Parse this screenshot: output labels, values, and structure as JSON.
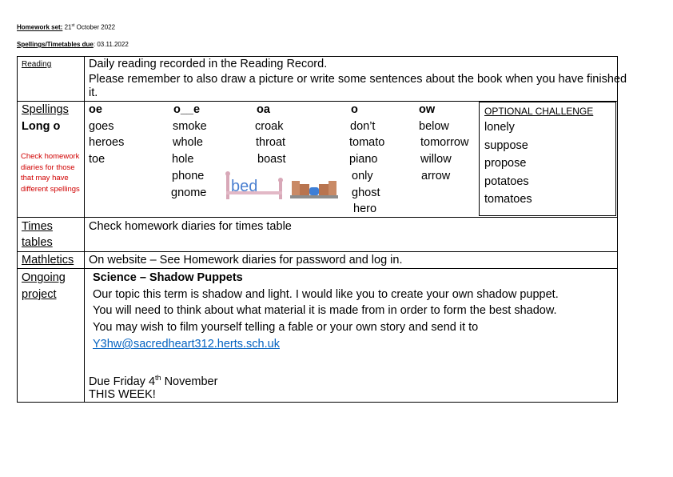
{
  "header": {
    "set_label": "Homework set:",
    "set_day": "21",
    "set_suffix": "st",
    "set_rest": "October 2022",
    "due_label": "Spellings/Timetables due",
    "due_value": ": 03.11.2022"
  },
  "reading": {
    "label": "Reading",
    "line1": "Daily reading recorded in the Reading Record.",
    "line2": "Please remember to also draw a picture or write some sentences about the book when you have finished",
    "line3": "it."
  },
  "spellings": {
    "label": "Spellings",
    "sublabel": "Long o",
    "note": "Check homework diaries for those that may have different spellings",
    "columns": [
      {
        "header": "oe",
        "words": [
          "goes",
          "heroes",
          "toe"
        ]
      },
      {
        "header": "o__e",
        "words": [
          "smoke",
          "whole",
          "hole",
          "phone",
          "gnome"
        ]
      },
      {
        "header": "oa",
        "words": [
          "croak",
          "throat",
          "boast"
        ]
      },
      {
        "header": "o",
        "words": [
          "don’t",
          "tomato",
          "piano",
          "only",
          "ghost",
          "hero"
        ]
      },
      {
        "header": "ow",
        "words": [
          "below",
          "tomorrow",
          "willow",
          "arrow"
        ]
      }
    ],
    "challenge": {
      "title": "OPTIONAL CHALLENGE",
      "words": [
        "lonely",
        "suppose",
        "propose",
        "potatoes",
        "tomatoes"
      ]
    },
    "pictures": {
      "bed_word": "bed"
    }
  },
  "times": {
    "label_line1": "Times",
    "label_line2": "tables",
    "text": "Check homework diaries for times table"
  },
  "mathletics": {
    "label": "Mathletics",
    "text": "On website – See Homework diaries for password and log in."
  },
  "ongoing": {
    "label_line1": "Ongoing",
    "label_line2": "project",
    "title": "Science – Shadow Puppets",
    "line1": "Our topic this term is shadow and light. I would like you to create your own shadow puppet.",
    "line2": "You will need to think about what material it is made from in order to form the best shadow.",
    "line3": "You may wish to film yourself telling a fable or your own story and send it to",
    "email": "Y3hw@sacredheart312.herts.sch.uk",
    "due_prefix": "Due Friday 4",
    "due_suffix": "th",
    "due_rest": "November",
    "this_week": "THIS WEEK!"
  },
  "colors": {
    "note_red": "#d00000",
    "link_blue": "#0563c1"
  }
}
